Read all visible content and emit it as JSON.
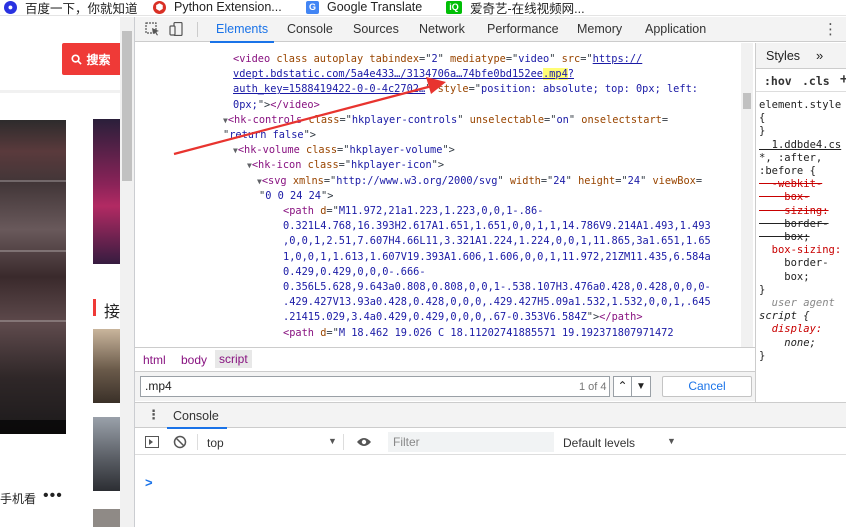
{
  "bookmarks": [
    {
      "label": "百度一下，你就知道",
      "icon": "baidu-paw-icon",
      "color": "#2932e1"
    },
    {
      "label": "Python Extension...",
      "icon": "extension-icon",
      "color": "#d93025"
    },
    {
      "label": "Google Translate",
      "icon": "google-translate-icon",
      "color": "#4285f4"
    },
    {
      "label": "爱奇艺-在线视频网...",
      "icon": "iqiyi-icon",
      "color": "#00be06"
    }
  ],
  "page": {
    "search_button": "搜索",
    "section_title": "接",
    "phone_text": "手机看",
    "more": "•••"
  },
  "devtools": {
    "tabs": [
      "Elements",
      "Console",
      "Sources",
      "Network",
      "Performance",
      "Memory",
      "Application"
    ],
    "active_tab": "Elements",
    "more_menu": "⋮",
    "dom_lines": [
      {
        "indent": 0,
        "html": "<span class='tag'>&lt;video</span> <span class='attr'>class</span> <span class='attr'>autoplay</span> <span class='attr'>tabindex</span>=\"<span class='val'>2</span>\" <span class='attr'>mediatype</span>=\"<span class='val'>video</span>\" <span class='attr'>src</span>=\"<span class='url'>https://</span>"
      },
      {
        "indent": 0,
        "html": "<span class='url'>vdept.bdstatic.com/5a4e433…/3134706a…74bfe0bd152ee<span class='hl'>.mp4</span>?</span>"
      },
      {
        "indent": 0,
        "html": "<span class='url'>auth_key=1588419422-0-0-4c2702…</span>\" <span class='attr'>style</span>=\"<span class='val'>position: absolute; top: 0px; left:</span>"
      },
      {
        "indent": 0,
        "html": "<span class='val'>0px;</span>\"&gt;<span class='tag'>&lt;/video&gt;</span>"
      },
      {
        "indent": -1,
        "html": "<span class='tri'>▼</span><span class='tag'>&lt;hk-controls</span> <span class='attr'>class</span>=\"<span class='val'>hkplayer-controls</span>\" <span class='attr'>unselectable</span>=\"<span class='val'>on</span>\" <span class='attr'>onselectstart</span>="
      },
      {
        "indent": -2,
        "html": "\"<span class='val'>return false</span>\"&gt;"
      },
      {
        "indent": 1,
        "html": "<span class='tri'>▼</span><span class='tag'>&lt;hk-volume</span> <span class='attr'>class</span>=\"<span class='val'>hkplayer-volume</span>\"&gt;"
      },
      {
        "indent": 2,
        "html": "<span class='tri'>▼</span><span class='tag'>&lt;hk-icon</span> <span class='attr'>class</span>=\"<span class='val'>hkplayer-icon</span>\"&gt;"
      },
      {
        "indent": 3,
        "html": "<span class='tri'>▼</span><span class='tag'>&lt;svg</span> <span class='attr'>xmlns</span>=\"<span class='val'>http://www.w3.org/2000/svg</span>\" <span class='attr'>width</span>=\"<span class='val'>24</span>\" <span class='attr'>height</span>=\"<span class='val'>24</span>\" <span class='attr'>viewBox</span>="
      },
      {
        "indent": 4,
        "html": "\"<span class='val'>0 0 24 24</span>\"&gt;"
      },
      {
        "indent": 5,
        "html": "<span class='tag'>&lt;path</span> <span class='attr'>d</span>=\"<span class='val'>M11.972,21a1.223,1.223,0,0,1-.86-</span>"
      },
      {
        "indent": 6,
        "html": "<span class='val'>0.321L4.768,16.393H2.617A1.651,1.651,0,0,1,1,14.786V9.214A1.493,1.493</span>"
      },
      {
        "indent": 6,
        "html": "<span class='val'>,0,0,1,2.51,7.607H4.66L11,3.321A1.224,1.224,0,0,1,11.865,3a1.651,1.65</span>"
      },
      {
        "indent": 6,
        "html": "<span class='val'>1,0,0,1,1.613,1.607V19.393A1.606,1.606,0,0,1,11.972,21ZM11.435,6.584a</span>"
      },
      {
        "indent": 6,
        "html": "<span class='val'>0.429,0.429,0,0,0-.666-</span>"
      },
      {
        "indent": 6,
        "html": "<span class='val'>0.356L5.628,9.643a0.808,0.808,0,0,1-.538.107H3.476a0.428,0.428,0,0,0-</span>"
      },
      {
        "indent": 6,
        "html": "<span class='val'>.429.427V13.93a0.428,0.428,0,0,0,.429.427H5.09a1.532,1.532,0,0,1,.645</span>"
      },
      {
        "indent": 6,
        "html": "<span class='val'>.21415.029,3.4a0.429,0.429,0,0,0,.67-0.353V6.584Z</span>\"&gt;<span class='tag'>&lt;/path&gt;</span>"
      },
      {
        "indent": 5,
        "html": "<span class='tag'>&lt;path</span> <span class='attr'>d</span>=\"<span class='val'>M 18.462 19.026 C 18.11202741885571 19.192371807971472</span>"
      }
    ],
    "breadcrumb": [
      "html",
      "body",
      "script"
    ],
    "find": {
      "value": ".mp4",
      "count": "1 of 4",
      "cancel": "Cancel"
    },
    "styles": {
      "tabs": [
        "Styles",
        "»"
      ],
      "filter_row": [
        ":hov",
        ".cls",
        "+"
      ],
      "lines": [
        {
          "t": "element.style",
          "c": "#222"
        },
        {
          "t": "{",
          "c": "#222"
        },
        {
          "t": "}",
          "c": "#222"
        },
        {
          "t": "  1.ddbde4.cs",
          "c": "#222",
          "u": true
        },
        {
          "t": "*, :after,",
          "c": "#222"
        },
        {
          "t": ":before {",
          "c": "#222"
        },
        {
          "t": "  -webkit-",
          "c": "#c80000",
          "s": true
        },
        {
          "t": "    box-",
          "c": "#c80000",
          "s": true
        },
        {
          "t": "    sizing:",
          "c": "#c80000",
          "s": true
        },
        {
          "t": "    border-",
          "c": "#222",
          "s": true
        },
        {
          "t": "    box;",
          "c": "#222",
          "s": true
        },
        {
          "t": "  box-sizing:",
          "c": "#c80000"
        },
        {
          "t": "    border-",
          "c": "#222"
        },
        {
          "t": "    box;",
          "c": "#222"
        },
        {
          "t": "}",
          "c": "#222"
        },
        {
          "t": "  user agent",
          "c": "#888",
          "i": true
        },
        {
          "t": "script {",
          "c": "#222",
          "i": true
        },
        {
          "t": "  display:",
          "c": "#c80000",
          "i": true
        },
        {
          "t": "    none;",
          "c": "#222",
          "i": true
        },
        {
          "t": "}",
          "c": "#222"
        }
      ]
    },
    "console": {
      "tab": "Console",
      "context": "top",
      "filter_placeholder": "Filter",
      "levels": "Default levels",
      "prompt": ">"
    }
  },
  "colors": {
    "accent": "#1a73e8",
    "search_red": "#ef3a37",
    "highlight": "#fffd74",
    "arrow": "#e8342f"
  }
}
